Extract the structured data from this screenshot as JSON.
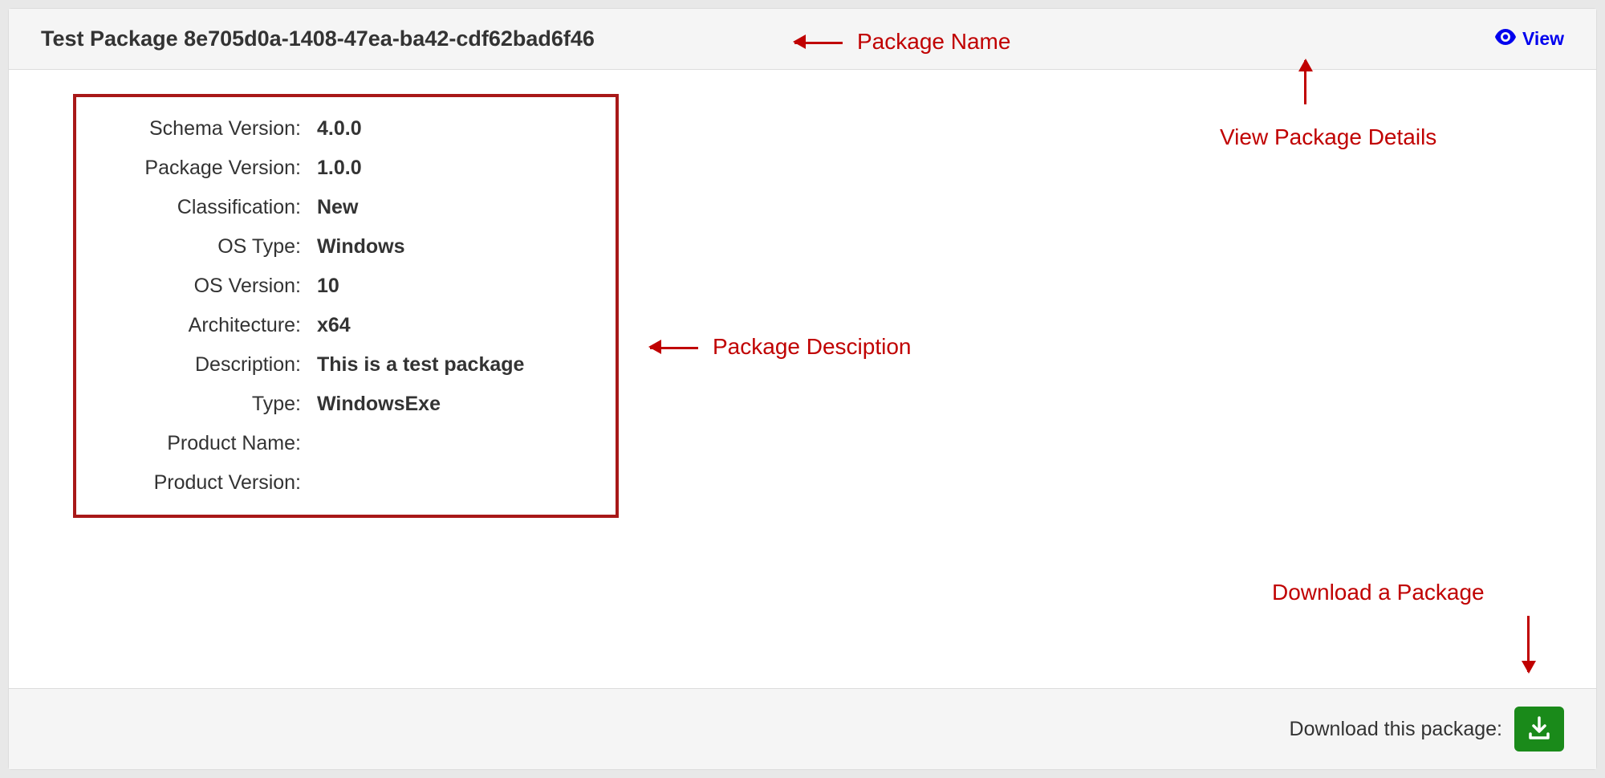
{
  "header": {
    "package_name": "Test Package 8e705d0a-1408-47ea-ba42-cdf62bad6f46",
    "view_label": "View"
  },
  "details": {
    "rows": [
      {
        "label": "Schema Version:",
        "value": "4.0.0"
      },
      {
        "label": "Package Version:",
        "value": "1.0.0"
      },
      {
        "label": "Classification:",
        "value": "New"
      },
      {
        "label": "OS Type:",
        "value": "Windows"
      },
      {
        "label": "OS Version:",
        "value": "10"
      },
      {
        "label": "Architecture:",
        "value": "x64"
      },
      {
        "label": "Description:",
        "value": "This is a test package"
      },
      {
        "label": "Type:",
        "value": "WindowsExe"
      },
      {
        "label": "Product Name:",
        "value": ""
      },
      {
        "label": "Product Version:",
        "value": ""
      }
    ]
  },
  "footer": {
    "download_label": "Download this package:"
  },
  "annotations": {
    "package_name": "Package Name",
    "view_details": "View Package Details",
    "package_description": "Package Desciption",
    "download_package": "Download  a Package"
  },
  "colors": {
    "annotation": "#c00000",
    "download_btn": "#1a8a1a",
    "link": "#0000ee"
  }
}
